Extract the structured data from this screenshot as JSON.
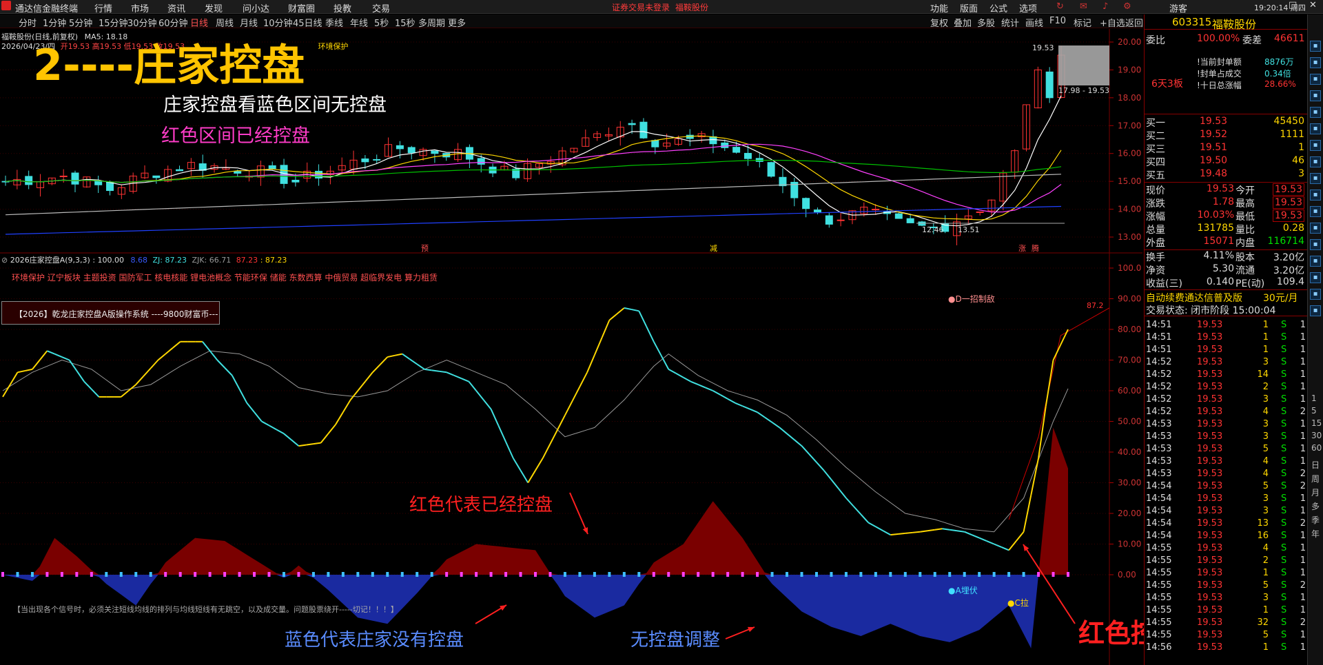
{
  "titlebar": {
    "app_name": "通达信金融终端",
    "menus": [
      "行情",
      "市场",
      "资讯",
      "发现",
      "问小达",
      "财富圈",
      "投教",
      "交易"
    ],
    "notice": "证券交易未登录",
    "stock_short": "福鞍股份",
    "right_menus": [
      "功能",
      "版面",
      "公式",
      "选项"
    ],
    "user": "游客",
    "clock": "19:20:14 周四"
  },
  "periods": {
    "items": [
      "分时",
      "1分钟",
      "5分钟",
      "15分钟",
      "30分钟",
      "60分钟",
      "日线",
      "周线",
      "月线",
      "10分钟",
      "45日线",
      "季线",
      "年线",
      "5秒",
      "15秒",
      "多周期",
      "更多"
    ],
    "active": "日线",
    "tools": [
      "复权",
      "叠加",
      "多股",
      "统计",
      "画线",
      "F10",
      "标记",
      "+自选",
      "返回"
    ]
  },
  "main_chart": {
    "stock_label": "福鞍股份(日线,前复权)",
    "ma_label": "MA5: 18.18",
    "date_line": "2026/04/23/四",
    "price_line": "开19.53 高19.53 低19.53 收19.53",
    "env_tag": "环境保护",
    "price_axis": [
      "20.00",
      "19.00",
      "18.00",
      "17.00",
      "16.00",
      "15.00",
      "14.00",
      "13.00"
    ],
    "high_mark": "19.53",
    "range_label": "17.98 - 19.53",
    "low_mark": "12.46",
    "low_mark2": "13.51",
    "events": [
      "预",
      "减",
      "涨",
      "腾"
    ]
  },
  "indicator": {
    "name": "2026庄家控盘A(9,3,3)",
    "value1": "100.00",
    "value2": "8.68",
    "zj": "ZJ: 87.23",
    "zjk": "ZJK: 66.71",
    "v3": "87.23",
    "v4": "87.23",
    "concepts": "环境保护 辽宁板块 主题投资 国防军工 核电核能 锂电池概念 节能环保 储能 东数西算 中俄贸易 超临界发电 算力租赁",
    "ad_box": "【2026】乾龙庄家控盘A版操作系统 ----9800财富币---",
    "axis": [
      "100.0",
      "90.00",
      "80.00",
      "70.00",
      "60.00",
      "50.00",
      "40.00",
      "30.00",
      "20.00",
      "10.00",
      "0.00"
    ],
    "label_d": "D一招制敌",
    "label_a": "A埋伏",
    "label_c": "C拉",
    "right_value": "87.2",
    "note": "【当出现各个信号时，必须关注短线均线的排列与均线短线有无跳空，以及成交量。问题股票绕开-----切记！！！】"
  },
  "annotations": {
    "big_title": "2----庄家控盘",
    "line1": "庄家控盘看蓝色区间无控盘",
    "line2": "红色区间已经控盘",
    "red_means": "红色代表已经控盘",
    "blue_means": "蓝色代表庄家没有控盘",
    "no_control": "无控盘调整",
    "red_rise": "红色控盘上涨"
  },
  "quote_panel": {
    "code": "603315",
    "name": "福鞍股份",
    "weibi_label": "委比",
    "weibi": "100.00%",
    "weicha_label": "委差",
    "weicha": "46611",
    "seal_lines": [
      {
        "label": "当前封单额",
        "value": "8876万"
      },
      {
        "label": "封单占成交",
        "value": "0.34倍"
      },
      {
        "label": "十日总涨幅",
        "value": "28.66%"
      }
    ],
    "board_tag": "6天3板",
    "bids": [
      {
        "label": "买一",
        "price": "19.53",
        "vol": "45450"
      },
      {
        "label": "买二",
        "price": "19.52",
        "vol": "1111"
      },
      {
        "label": "买三",
        "price": "19.51",
        "vol": "1"
      },
      {
        "label": "买四",
        "price": "19.50",
        "vol": "46"
      },
      {
        "label": "买五",
        "price": "19.48",
        "vol": "3"
      }
    ],
    "stats": [
      {
        "l1": "现价",
        "v1": "19.53",
        "l2": "今开",
        "v2": "19.53"
      },
      {
        "l1": "涨跌",
        "v1": "1.78",
        "l2": "最高",
        "v2": "19.53"
      },
      {
        "l1": "涨幅",
        "v1": "10.03%",
        "l2": "最低",
        "v2": "19.53"
      },
      {
        "l1": "总量",
        "v1": "131785",
        "l2": "量比",
        "v2": "0.28"
      },
      {
        "l1": "外盘",
        "v1": "15071",
        "l2": "内盘",
        "v2": "116714"
      }
    ],
    "stats2": [
      {
        "l1": "换手",
        "v1": "4.11%",
        "l2": "股本",
        "v2": "3.20亿"
      },
      {
        "l1": "净资",
        "v1": "5.30",
        "l2": "流通",
        "v2": "3.20亿"
      },
      {
        "l1": "收益(三)",
        "v1": "0.140",
        "l2": "PE(动)",
        "v2": "109.4"
      }
    ],
    "promo": "自动续费通达信普及版",
    "promo_price": "30元/月",
    "trade_status": "交易状态: 闭市阶段 15:00:04",
    "ticks": [
      {
        "t": "14:51",
        "p": "19.53",
        "v": "1",
        "s": "S",
        "n": "1"
      },
      {
        "t": "14:51",
        "p": "19.53",
        "v": "1",
        "s": "S",
        "n": "1"
      },
      {
        "t": "14:51",
        "p": "19.53",
        "v": "1",
        "s": "S",
        "n": "1"
      },
      {
        "t": "14:52",
        "p": "19.53",
        "v": "3",
        "s": "S",
        "n": "1"
      },
      {
        "t": "14:52",
        "p": "19.53",
        "v": "14",
        "s": "S",
        "n": "1"
      },
      {
        "t": "14:52",
        "p": "19.53",
        "v": "2",
        "s": "S",
        "n": "1"
      },
      {
        "t": "14:52",
        "p": "19.53",
        "v": "3",
        "s": "S",
        "n": "1"
      },
      {
        "t": "14:52",
        "p": "19.53",
        "v": "4",
        "s": "S",
        "n": "2"
      },
      {
        "t": "14:53",
        "p": "19.53",
        "v": "3",
        "s": "S",
        "n": "1"
      },
      {
        "t": "14:53",
        "p": "19.53",
        "v": "3",
        "s": "S",
        "n": "1"
      },
      {
        "t": "14:53",
        "p": "19.53",
        "v": "5",
        "s": "S",
        "n": "1"
      },
      {
        "t": "14:53",
        "p": "19.53",
        "v": "4",
        "s": "S",
        "n": "1"
      },
      {
        "t": "14:53",
        "p": "19.53",
        "v": "4",
        "s": "S",
        "n": "2"
      },
      {
        "t": "14:54",
        "p": "19.53",
        "v": "5",
        "s": "S",
        "n": "2"
      },
      {
        "t": "14:54",
        "p": "19.53",
        "v": "3",
        "s": "S",
        "n": "1"
      },
      {
        "t": "14:54",
        "p": "19.53",
        "v": "3",
        "s": "S",
        "n": "1"
      },
      {
        "t": "14:54",
        "p": "19.53",
        "v": "13",
        "s": "S",
        "n": "2"
      },
      {
        "t": "14:54",
        "p": "19.53",
        "v": "16",
        "s": "S",
        "n": "1"
      },
      {
        "t": "14:55",
        "p": "19.53",
        "v": "4",
        "s": "S",
        "n": "1"
      },
      {
        "t": "14:55",
        "p": "19.53",
        "v": "2",
        "s": "S",
        "n": "1"
      },
      {
        "t": "14:55",
        "p": "19.53",
        "v": "1",
        "s": "S",
        "n": "1"
      },
      {
        "t": "14:55",
        "p": "19.53",
        "v": "5",
        "s": "S",
        "n": "2"
      },
      {
        "t": "14:55",
        "p": "19.53",
        "v": "3",
        "s": "S",
        "n": "1"
      },
      {
        "t": "14:55",
        "p": "19.53",
        "v": "1",
        "s": "S",
        "n": "1"
      },
      {
        "t": "14:55",
        "p": "19.53",
        "v": "32",
        "s": "S",
        "n": "2"
      },
      {
        "t": "14:55",
        "p": "19.53",
        "v": "5",
        "s": "S",
        "n": "1"
      },
      {
        "t": "14:56",
        "p": "19.53",
        "v": "1",
        "s": "S",
        "n": "1"
      }
    ]
  },
  "sidebar": {
    "labels": [
      "日",
      "周",
      "月",
      "多",
      "季",
      "年"
    ]
  },
  "colors": {
    "up": "#ff3333",
    "down": "#40e0e0",
    "blue_area": "#1a2aa0",
    "red_area": "#7a0000",
    "yellow": "#ffd700",
    "magenta": "#ff40ff"
  }
}
